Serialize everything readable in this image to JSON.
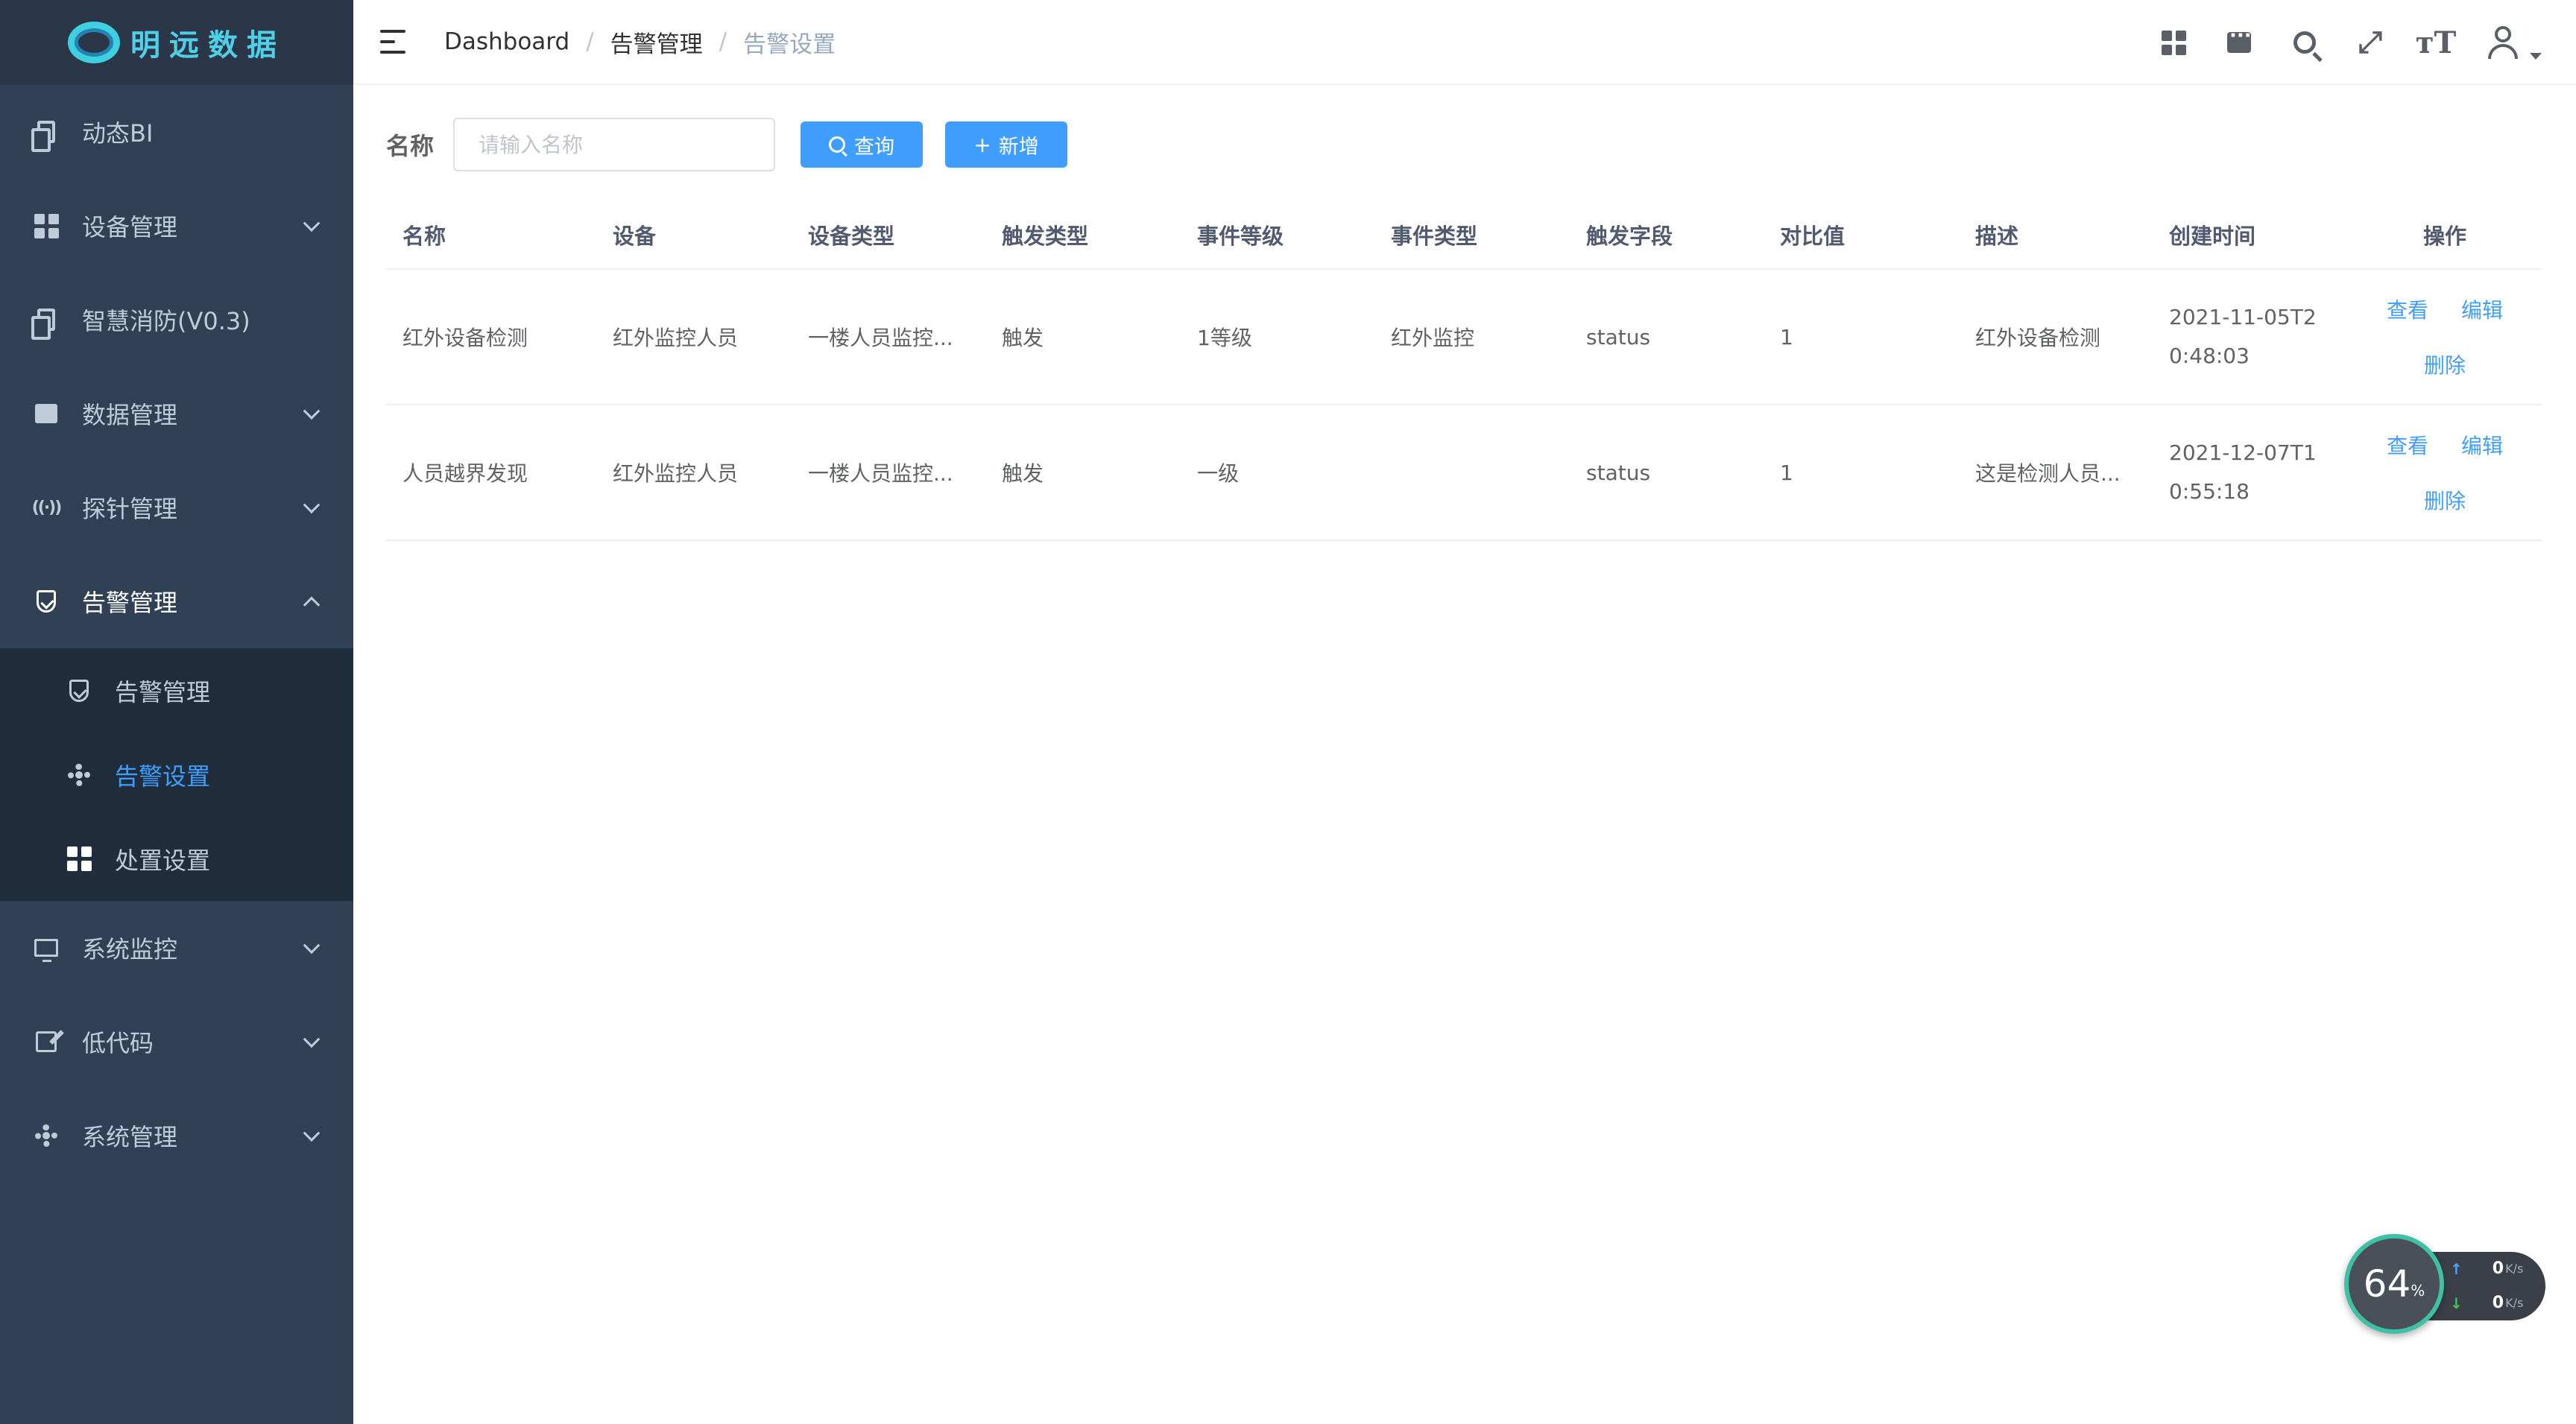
{
  "brand": {
    "name": "明远数据"
  },
  "sidebar": {
    "items": [
      {
        "label": "动态BI",
        "icon": "doc-icon",
        "expandable": false
      },
      {
        "label": "设备管理",
        "icon": "grid-icon",
        "expandable": true
      },
      {
        "label": "智慧消防(V0.3)",
        "icon": "doc-icon",
        "expandable": false
      },
      {
        "label": "数据管理",
        "icon": "book-icon",
        "expandable": true
      },
      {
        "label": "探针管理",
        "icon": "probe-icon",
        "expandable": true
      },
      {
        "label": "告警管理",
        "icon": "shield-icon",
        "expandable": true,
        "expanded": true
      },
      {
        "label": "系统监控",
        "icon": "monitor-icon",
        "expandable": true
      },
      {
        "label": "低代码",
        "icon": "edit-icon",
        "expandable": true
      },
      {
        "label": "系统管理",
        "icon": "gear-icon",
        "expandable": true
      }
    ],
    "submenu": [
      {
        "label": "告警管理",
        "icon": "shield-icon",
        "active": false
      },
      {
        "label": "告警设置",
        "icon": "gear-icon",
        "active": true
      },
      {
        "label": "处置设置",
        "icon": "grid-icon",
        "active": false
      }
    ]
  },
  "header": {
    "breadcrumb": [
      "Dashboard",
      "告警管理",
      "告警设置"
    ],
    "separator": "/",
    "icons": [
      "grid-icon",
      "chat-icon",
      "search-icon",
      "fullscreen-icon",
      "text-size-icon",
      "user-avatar-icon"
    ]
  },
  "search": {
    "label": "名称",
    "placeholder": "请输入名称",
    "query_label": "查询",
    "add_label": "新增"
  },
  "table": {
    "columns": [
      "名称",
      "设备",
      "设备类型",
      "触发类型",
      "事件等级",
      "事件类型",
      "触发字段",
      "对比值",
      "描述",
      "创建时间",
      "操作"
    ],
    "rows": [
      {
        "name": "红外设备检测",
        "device": "红外监控人员",
        "device_type": "一楼人员监控...",
        "trigger_type": "触发",
        "event_level": "1等级",
        "event_type": "红外监控",
        "trigger_field": "status",
        "compare_value": "1",
        "description": "红外设备检测",
        "created_at": "2021-11-05T20:48:03"
      },
      {
        "name": "人员越界发现",
        "device": "红外监控人员",
        "device_type": "一楼人员监控...",
        "trigger_type": "触发",
        "event_level": "一级",
        "event_type": "",
        "trigger_field": "status",
        "compare_value": "1",
        "description": "这是检测人员...",
        "created_at": "2021-12-07T10:55:18"
      }
    ],
    "actions": {
      "view": "查看",
      "edit": "编辑",
      "delete": "删除"
    }
  },
  "net_widget": {
    "value": "64",
    "unit": "%",
    "upload": "0",
    "download": "0",
    "speed_unit": "K/s"
  },
  "colors": {
    "sidebar_bg": "#304156",
    "submenu_bg": "#1f2d3d",
    "accent": "#409eff",
    "brand": "#4fd0e6"
  }
}
